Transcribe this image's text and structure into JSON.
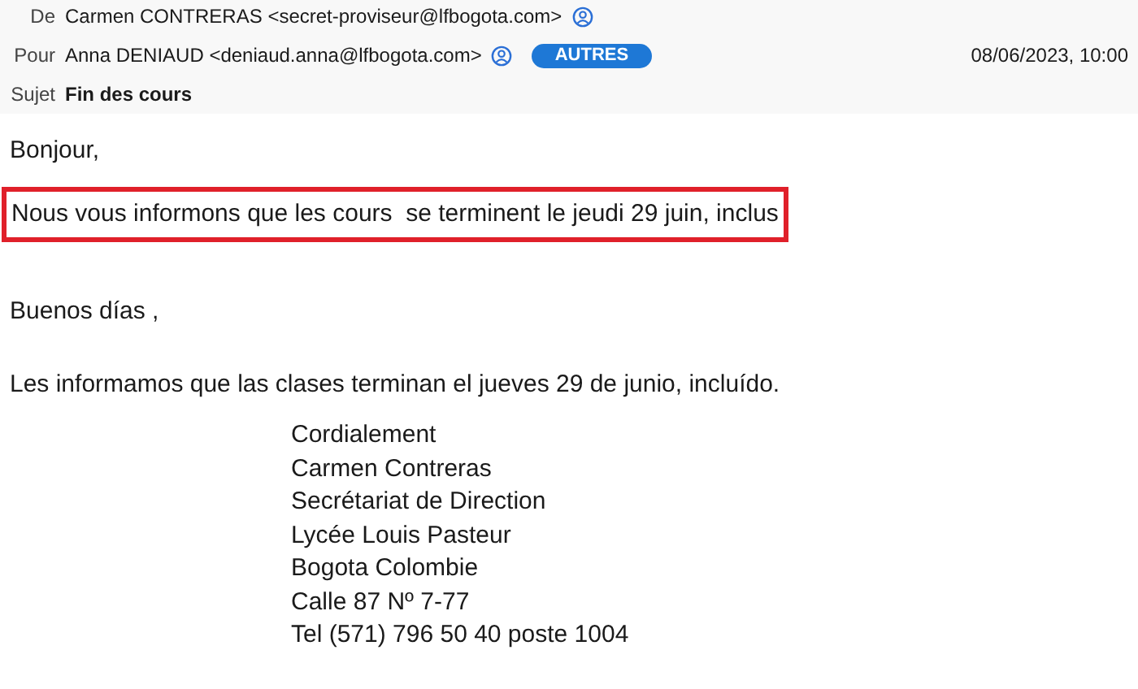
{
  "header": {
    "from": {
      "label": "De",
      "value": "Carmen CONTRERAS <secret-proviseur@lfbogota.com>"
    },
    "to": {
      "label": "Pour",
      "value": "Anna DENIAUD <deniaud.anna@lfbogota.com>",
      "tag": "AUTRES"
    },
    "date": "08/06/2023, 10:00",
    "subject": {
      "label": "Sujet",
      "value": "Fin des cours"
    }
  },
  "body": [
    {
      "text": "Bonjour,",
      "highlighted": false
    },
    {
      "text": "Nous vous informons que les cours  se terminent le jeudi 29 juin, inclus",
      "highlighted": true
    },
    {
      "text": "Buenos días ,",
      "highlighted": false
    },
    {
      "text": "Les informamos que las clases terminan el jueves 29 de junio, incluído.",
      "highlighted": false
    }
  ],
  "signature": [
    "Cordialement",
    "Carmen Contreras",
    "Secrétariat de Direction",
    "Lycée Louis Pasteur",
    "Bogota Colombie",
    "Calle 87 Nº 7-77",
    "Tel (571) 796 50 40 poste 1004"
  ]
}
